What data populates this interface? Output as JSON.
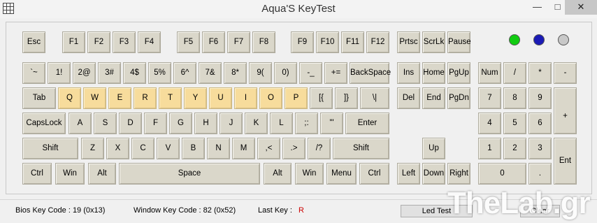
{
  "window": {
    "title": "Aqua'S KeyTest",
    "minimize": "—",
    "maximize": "□",
    "close": "✕"
  },
  "keys": {
    "esc": "Esc",
    "f1": "F1",
    "f2": "F2",
    "f3": "F3",
    "f4": "F4",
    "f5": "F5",
    "f6": "F6",
    "f7": "F7",
    "f8": "F8",
    "f9": "F9",
    "f10": "F10",
    "f11": "F11",
    "f12": "F12",
    "prtsc": "Prtsc",
    "scrlk": "ScrLk",
    "pause": "Pause",
    "backtick": "`~",
    "n1": "1!",
    "n2": "2@",
    "n3": "3#",
    "n4": "4$",
    "n5": "5%",
    "n6": "6^",
    "n7": "7&",
    "n8": "8*",
    "n9": "9(",
    "n0": "0)",
    "minus": "-_",
    "equals": "+=",
    "backspace": "BackSpace",
    "ins": "Ins",
    "home": "Home",
    "pgup": "PgUp",
    "numlock": "Num",
    "npslash": "/",
    "npstar": "*",
    "npminus": "-",
    "tab": "Tab",
    "q": "Q",
    "w": "W",
    "e": "E",
    "r": "R",
    "t": "T",
    "y": "Y",
    "u": "U",
    "i": "I",
    "o": "O",
    "p": "P",
    "lbracket": "[{",
    "rbracket": "]}",
    "backslash": "\\|",
    "del": "Del",
    "end": "End",
    "pgdn": "PgDn",
    "np7": "7",
    "np8": "8",
    "np9": "9",
    "npplus": "+",
    "capslock": "CapsLock",
    "a": "A",
    "s": "S",
    "d": "D",
    "f": "F",
    "g": "G",
    "h": "H",
    "j": "J",
    "k": "K",
    "l": "L",
    "semicolon": ";:",
    "quote": "'\"",
    "enter": "Enter",
    "np4": "4",
    "np5": "5",
    "np6": "6",
    "lshift": "Shift",
    "z": "Z",
    "x": "X",
    "c": "C",
    "v": "V",
    "b": "B",
    "n": "N",
    "m": "M",
    "comma": ",<",
    "period": ".>",
    "slash": "/?",
    "rshift": "Shift",
    "up": "Up",
    "np1": "1",
    "np2": "2",
    "np3": "3",
    "npenter": "Ent",
    "lctrl": "Ctrl",
    "lwin": "Win",
    "lalt": "Alt",
    "space": "Space",
    "ralt": "Alt",
    "rwin": "Win",
    "menu": "Menu",
    "rctrl": "Ctrl",
    "left": "Left",
    "down": "Down",
    "right": "Right",
    "np0": "0",
    "npdot": "."
  },
  "leds": {
    "numlock_color": "#11cc11",
    "capslock_color": "#1a1ab5",
    "scroll_color": "#c8c8c8"
  },
  "key_colors": {
    "default": "#dad7ca",
    "pressed": "#f7dc9c"
  },
  "status": {
    "bios_label": "Bios Key Code :",
    "bios_value": "19 (0x13)",
    "window_label": "Window Key Code :",
    "window_value": "82 (0x52)",
    "last_label": "Last Key :",
    "last_value": "R",
    "led_test": "Led Test",
    "clear": "Clear"
  },
  "watermark": "TheLab.gr"
}
